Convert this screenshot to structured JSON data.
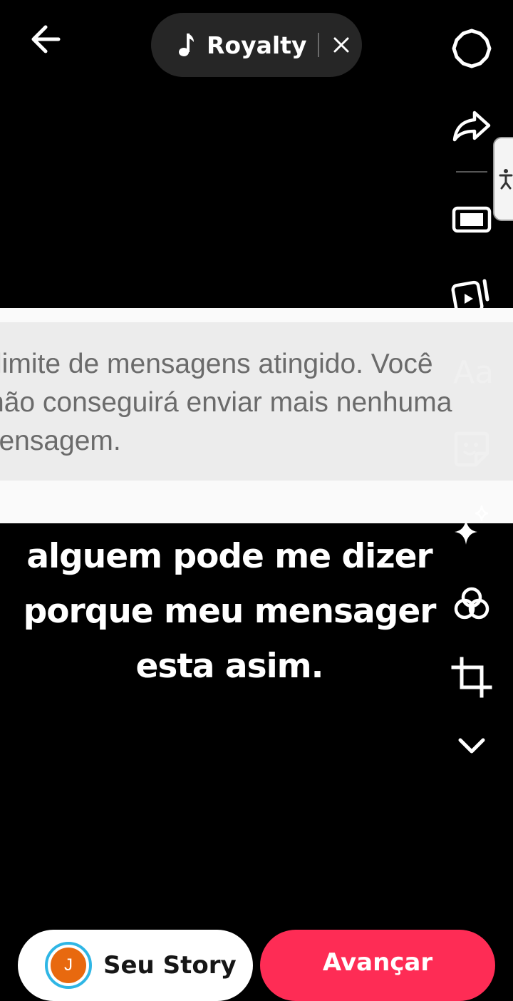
{
  "topbar": {
    "back_icon": "arrow-left-icon",
    "music": {
      "icon": "music-note-icon",
      "title": "Royalty",
      "close_icon": "close-icon"
    }
  },
  "tools": [
    {
      "name": "settings-icon"
    },
    {
      "name": "share-icon"
    },
    {
      "name": "accessibility-icon"
    },
    {
      "name": "aspect-ratio-icon"
    },
    {
      "name": "video-template-icon"
    },
    {
      "name": "text-icon",
      "label": "Aa"
    },
    {
      "name": "sticker-icon"
    },
    {
      "name": "effects-icon"
    },
    {
      "name": "filters-icon"
    },
    {
      "name": "crop-icon"
    },
    {
      "name": "chevron-down-icon"
    }
  ],
  "screenshot": {
    "lines": [
      "limite de mensagens atingido. Você",
      "não conseguirá enviar mais nenhuma",
      "mensagem."
    ]
  },
  "caption": {
    "lines": [
      "alguem pode me dizer",
      "porque meu mensager",
      "esta asim."
    ]
  },
  "bottom": {
    "story_label": "Seu Story",
    "avatar_letter": "J",
    "next_label": "Avançar"
  },
  "colors": {
    "accent": "#fe2c55",
    "avatar_bg": "#e8690f",
    "avatar_ring": "#2fb6e5",
    "pill_bg": "#262626"
  }
}
